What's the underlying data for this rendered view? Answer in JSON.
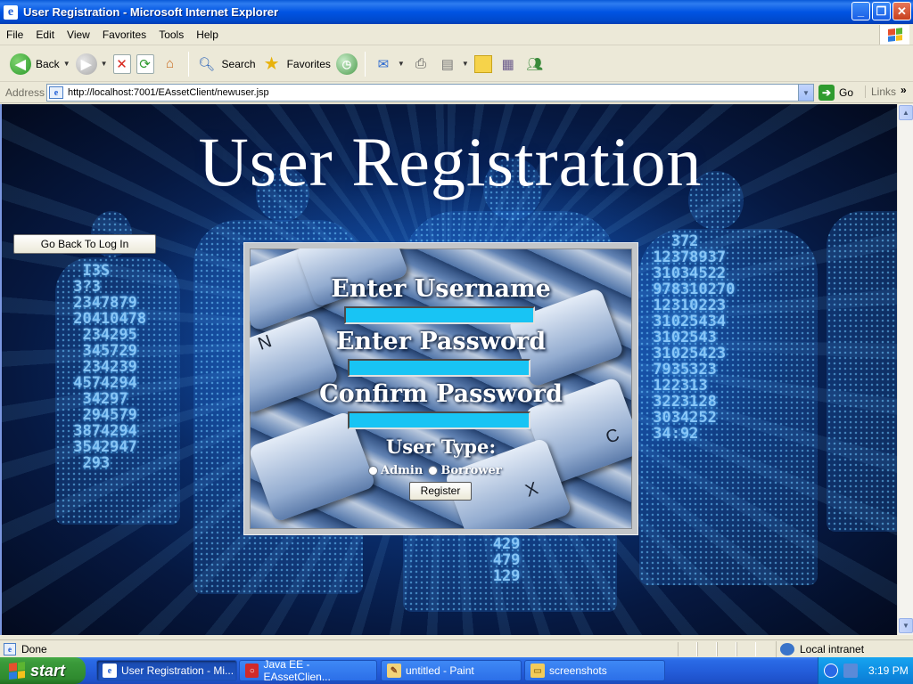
{
  "window": {
    "title": "User Registration - Microsoft Internet Explorer"
  },
  "menu": [
    "File",
    "Edit",
    "View",
    "Favorites",
    "Tools",
    "Help"
  ],
  "toolbar": {
    "back_label": "Back",
    "search_label": "Search",
    "favorites_label": "Favorites"
  },
  "address": {
    "label": "Address",
    "url": "http://localhost:7001/EAssetClient/newuser.jsp",
    "go_label": "Go",
    "links_label": "Links"
  },
  "page": {
    "title": "User Registration",
    "back_button": "Go Back To Log In",
    "form": {
      "username_label": "Enter Username",
      "password_label": "Enter Password",
      "confirm_label": "Confirm Password",
      "user_type_label": "User Type:",
      "option_admin": "Admin",
      "option_borrower": "Borrower",
      "register_button": "Register",
      "username_value": "",
      "password_value": "",
      "confirm_value": ""
    }
  },
  "status": {
    "text": "Done",
    "zone": "Local intranet"
  },
  "taskbar": {
    "start_label": "start",
    "tasks": [
      "User Registration - Mi...",
      "Java EE - EAssetClien...",
      "untitled - Paint",
      "screenshots"
    ],
    "clock": "3:19 PM"
  },
  "colors": {
    "input_fill": "#18c4f4",
    "titlebar": "#0054e3",
    "taskbar": "#245edb",
    "start": "#3a9a3a"
  }
}
